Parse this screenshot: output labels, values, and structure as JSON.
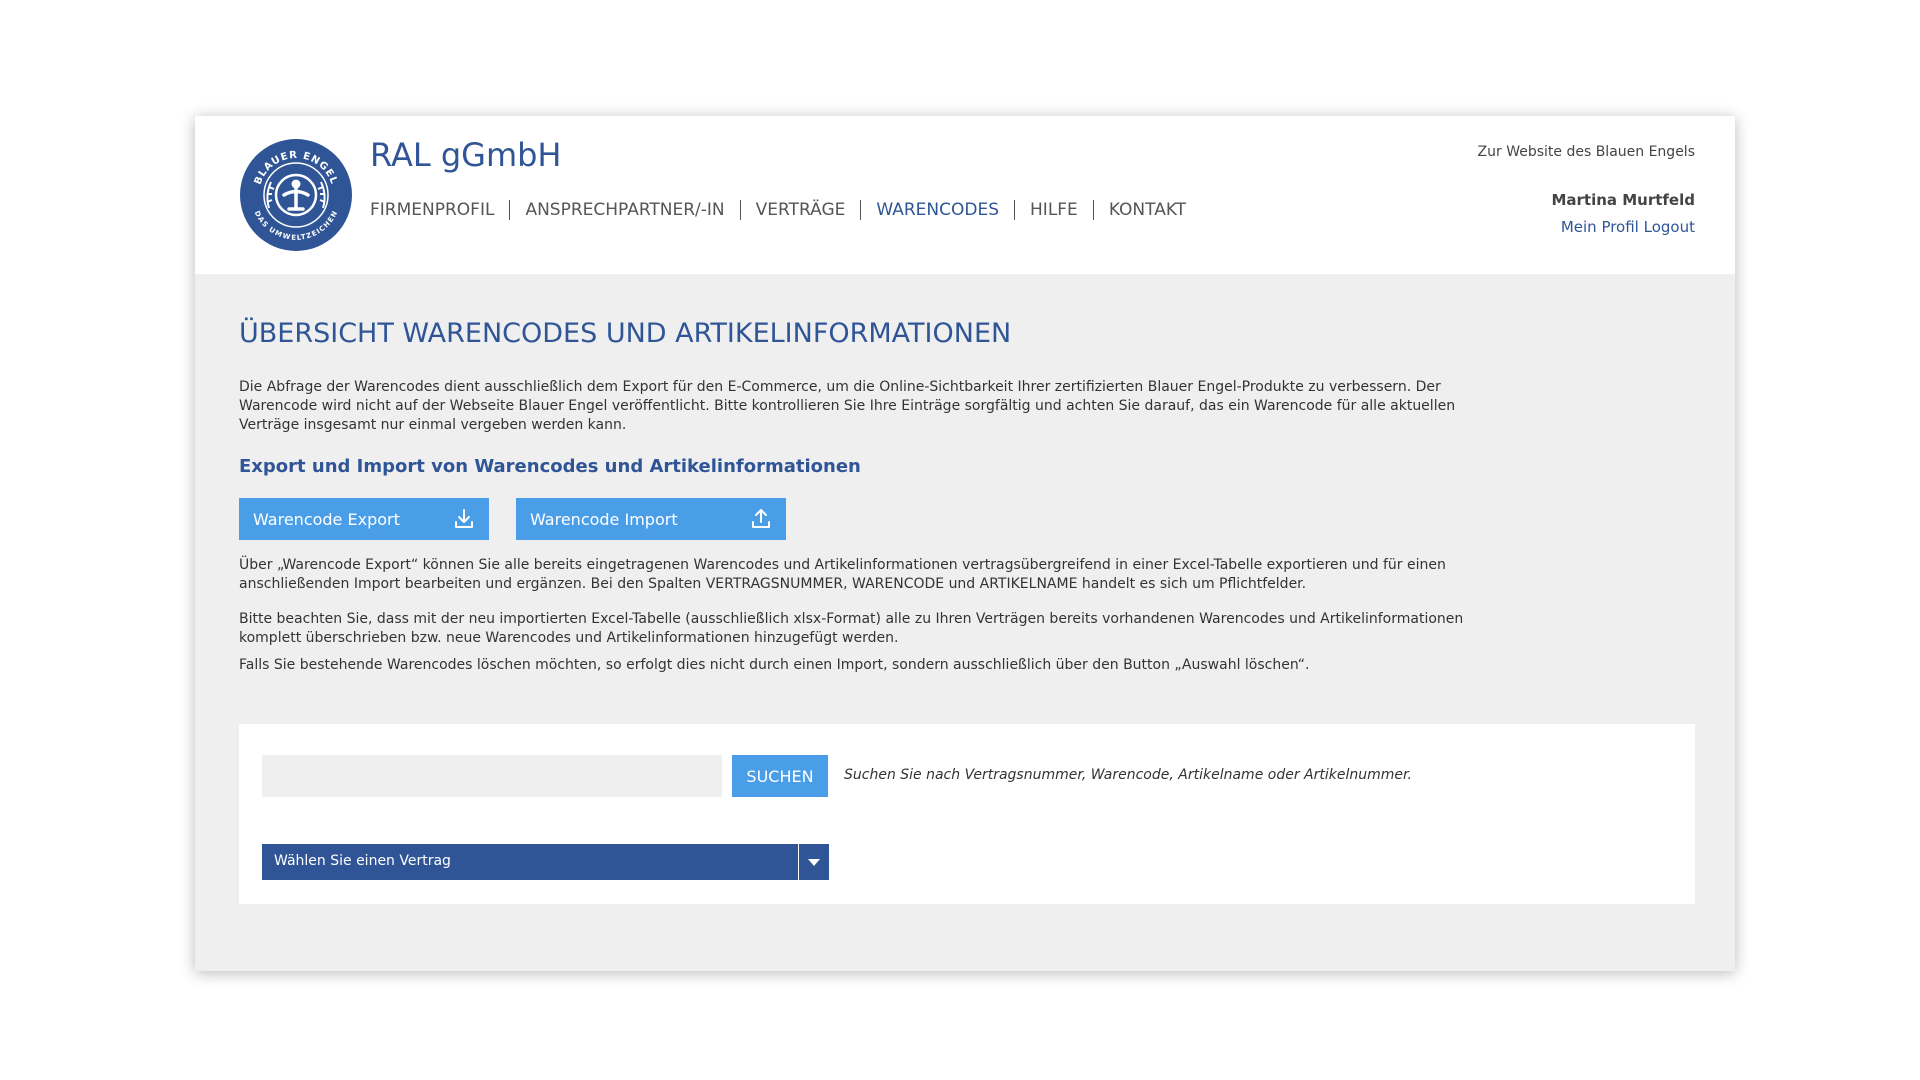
{
  "header": {
    "brand": "RAL gGmbH",
    "logo": {
      "icon": "blue-angel-logo-icon",
      "top_text": "BLAUER ENGEL",
      "bottom_text": "DAS UMWELTZEICHEN",
      "color": "#2f5597"
    },
    "nav": [
      {
        "label": "FIRMENPROFIL",
        "active": false
      },
      {
        "label": "ANSPRECHPARTNER/-IN",
        "active": false
      },
      {
        "label": "VERTRÄGE",
        "active": false
      },
      {
        "label": "WARENCODES",
        "active": true
      },
      {
        "label": "HILFE",
        "active": false
      },
      {
        "label": "KONTAKT",
        "active": false
      }
    ],
    "website_link": "Zur Website des Blauen Engels",
    "user_name": "Martina Murtfeld",
    "profile_link": "Mein Profil",
    "logout_link": "Logout"
  },
  "main": {
    "title": "ÜBERSICHT WARENCODES UND ARTIKELINFORMATIONEN",
    "intro": "Die Abfrage der Warencodes dient ausschließlich dem Export für den E-Commerce, um die Online-Sichtbarkeit Ihrer zertifizierten Blauer Engel-Produkte zu verbessern. Der Warencode wird nicht auf der Webseite Blauer Engel veröffentlicht. Bitte kontrollieren Sie Ihre Einträge sorgfältig und achten Sie darauf, das ein Warencode für alle aktuellen Verträge insgesamt nur einmal vergeben werden kann.",
    "section_title": "Export und Import von Warencodes und Artikelinformationen",
    "export_button": {
      "label": "Warencode Export",
      "icon": "download-icon"
    },
    "import_button": {
      "label": "Warencode Import",
      "icon": "upload-icon"
    },
    "info_1": "Über „Warencode Export“ können Sie alle bereits eingetragenen Warencodes und Artikelinformationen vertragsübergreifend in einer Excel-Tabelle exportieren und für einen anschließenden Import bearbeiten und ergänzen. Bei den Spalten VERTRAGSNUMMER, WARENCODE und ARTIKELNAME handelt es sich um Pflichtfelder.",
    "info_2": "Bitte beachten Sie, dass mit der neu importierten Excel-Tabelle (ausschließlich xlsx-Format) alle zu Ihren Verträgen bereits vorhandenen Warencodes und Artikelinformationen komplett überschrieben bzw. neue Warencodes und Artikelinformationen hinzugefügt werden.",
    "info_3": "Falls Sie bestehende Warencodes löschen möchten, so erfolgt dies nicht durch einen Import, sondern ausschließlich über den Button „Auswahl löschen“."
  },
  "search": {
    "value": "",
    "placeholder": "",
    "button_label": "SUCHEN",
    "hint": "Suchen Sie nach Vertragsnummer, Warencode, Artikelname oder Artikelnummer.",
    "select_label": "Wählen Sie einen Vertrag",
    "select_icon": "chevron-down-icon"
  },
  "colors": {
    "primary": "#2f5597",
    "button": "#4a9ee8",
    "background": "#efefef"
  }
}
